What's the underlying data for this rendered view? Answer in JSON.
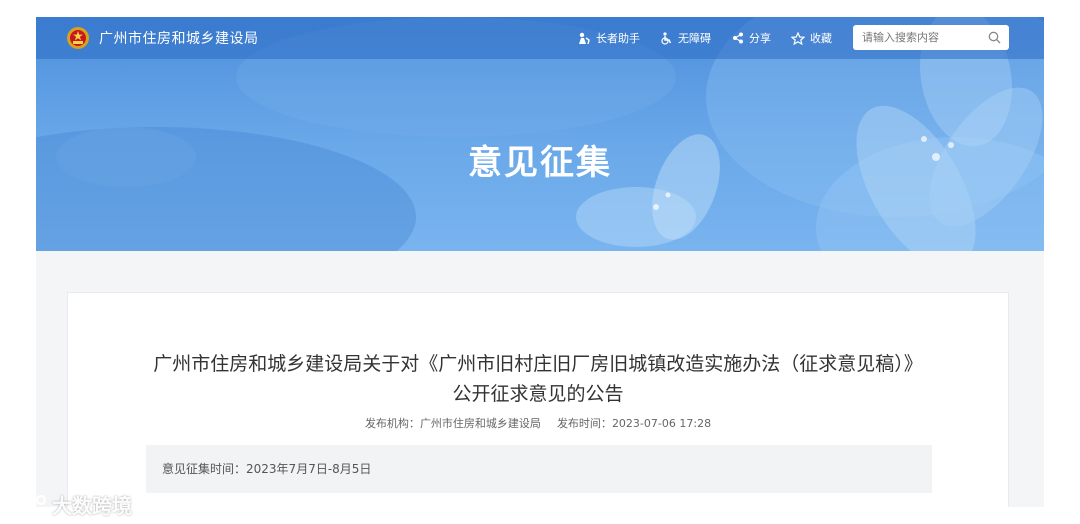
{
  "header": {
    "site_title": "广州市住房和城乡建设局",
    "tools": {
      "elder": "长者助手",
      "accessibility": "无障碍",
      "share": "分享",
      "favorite": "收藏"
    },
    "search": {
      "placeholder": "请输入搜索内容"
    }
  },
  "banner": {
    "title": "意见征集"
  },
  "article": {
    "title_line1": "广州市住房和城乡建设局关于对《广州市旧村庄旧厂房旧城镇改造实施办法（征求意见稿）》",
    "title_line2": "公开征求意见的公告",
    "publisher_label": "发布机构：",
    "publisher": "广州市住房和城乡建设局",
    "time_label": "发布时间：",
    "time": "2023-07-06 17:28",
    "period_label": "意见征集时间：",
    "period": "2023年7月7日-8月5日"
  },
  "watermark": {
    "text": "大数跨境"
  },
  "colors": {
    "banner": "#5b9be3",
    "topbar": "#2c6cc4",
    "text": "#333333"
  }
}
